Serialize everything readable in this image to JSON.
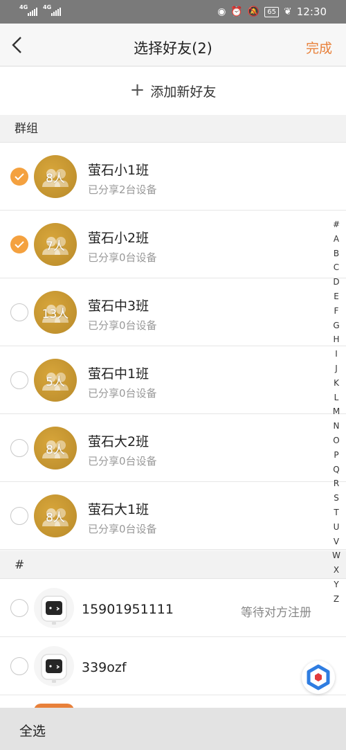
{
  "status_bar": {
    "net1": "4G",
    "net2": "4G",
    "battery": "65",
    "time": "12:30"
  },
  "nav": {
    "title": "选择好友(2)",
    "done_label": "完成"
  },
  "add_friend_label": "添加新好友",
  "groups_header": "群组",
  "groups": [
    {
      "name": "萤石小1班",
      "sub": "已分享2台设备",
      "count": "8人",
      "checked": true
    },
    {
      "name": "萤石小2班",
      "sub": "已分享0台设备",
      "count": "7人",
      "checked": true
    },
    {
      "name": "萤石中3班",
      "sub": "已分享0台设备",
      "count": "13人",
      "checked": false
    },
    {
      "name": "萤石中1班",
      "sub": "已分享0台设备",
      "count": "5人",
      "checked": false
    },
    {
      "name": "萤石大2班",
      "sub": "已分享0台设备",
      "count": "8人",
      "checked": false
    },
    {
      "name": "萤石大1班",
      "sub": "已分享0台设备",
      "count": "8人",
      "checked": false
    }
  ],
  "contacts_header": "#",
  "contacts": [
    {
      "name": "15901951111",
      "status": "等待对方注册"
    },
    {
      "name": "339ozf",
      "status": ""
    }
  ],
  "index_letters": [
    "#",
    "A",
    "B",
    "C",
    "D",
    "E",
    "F",
    "G",
    "H",
    "I",
    "J",
    "K",
    "L",
    "M",
    "N",
    "O",
    "P",
    "Q",
    "R",
    "S",
    "T",
    "U",
    "V",
    "W",
    "X",
    "Y",
    "Z"
  ],
  "bottom": {
    "select_all": "全选"
  },
  "colors": {
    "accent": "#e8803a",
    "check": "#f4a13f",
    "avatar": "#c99a30"
  }
}
